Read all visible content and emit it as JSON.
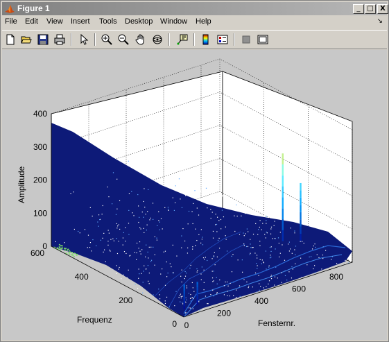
{
  "window": {
    "title": "Figure 1"
  },
  "window_buttons": {
    "minimize": "_",
    "maximize": "□",
    "close": "X"
  },
  "menu": {
    "items": [
      {
        "label": "File"
      },
      {
        "label": "Edit"
      },
      {
        "label": "View"
      },
      {
        "label": "Insert"
      },
      {
        "label": "Tools"
      },
      {
        "label": "Desktop"
      },
      {
        "label": "Window"
      },
      {
        "label": "Help"
      }
    ],
    "dock_arrow": "↘"
  },
  "toolbar": {
    "tools": [
      "new-figure-icon",
      "open-file-icon",
      "save-icon",
      "print-icon",
      "edit-plot-arrow-icon",
      "zoom-in-icon",
      "zoom-out-icon",
      "pan-hand-icon",
      "rotate-3d-icon",
      "data-cursor-icon",
      "insert-colorbar-icon",
      "insert-legend-icon",
      "hide-plot-tools-icon",
      "show-plot-tools-icon"
    ]
  },
  "chart_data": {
    "type": "surface",
    "title": "",
    "xlabel": "Fensternr.",
    "ylabel": "Frequenz",
    "zlabel": "Amplitude",
    "xlim": [
      0,
      900
    ],
    "ylim": [
      0,
      600
    ],
    "zlim": [
      0,
      400
    ],
    "x_ticks": [
      "0",
      "200",
      "400",
      "600",
      "800"
    ],
    "y_ticks": [
      "0",
      "200",
      "400",
      "600"
    ],
    "z_ticks": [
      "0",
      "100",
      "200",
      "300",
      "400"
    ],
    "grid": true,
    "colormap": "jet",
    "peaks": [
      {
        "fenster": 50,
        "frequenz": 40,
        "amplitude": 75
      },
      {
        "fenster": 120,
        "frequenz": 40,
        "amplitude": 70
      },
      {
        "fenster": 800,
        "frequenz": 230,
        "amplitude": 265
      },
      {
        "fenster": 860,
        "frequenz": 200,
        "amplitude": 175
      }
    ],
    "low_frequency_ridge": {
      "frequenz": 600,
      "amplitude": 400
    }
  }
}
